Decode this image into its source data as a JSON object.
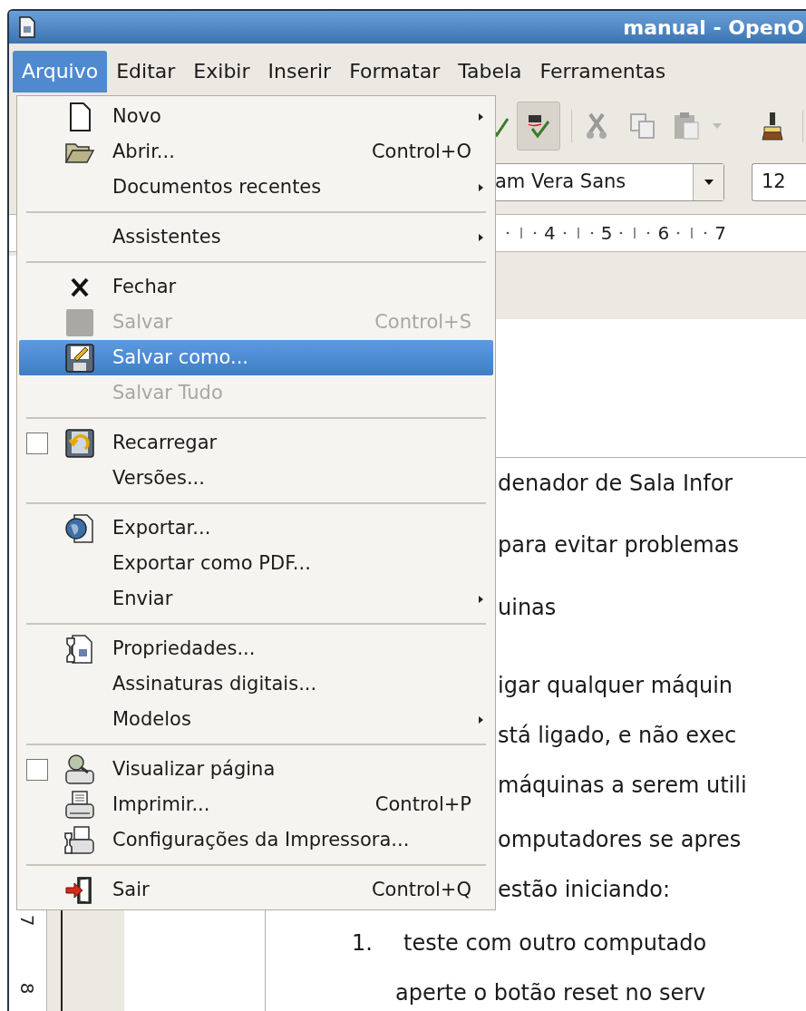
{
  "window": {
    "title": "manual - OpenO"
  },
  "menubar": [
    {
      "label": "Arquivo",
      "selected": true
    },
    {
      "label": "Editar",
      "selected": false
    },
    {
      "label": "Exibir",
      "selected": false
    },
    {
      "label": "Inserir",
      "selected": false
    },
    {
      "label": "Formatar",
      "selected": false
    },
    {
      "label": "Tabela",
      "selected": false
    },
    {
      "label": "Ferramentas",
      "selected": false
    }
  ],
  "toolbar": {
    "auto_spellcheck_on": true,
    "font_name": "am Vera Sans",
    "font_size": "12"
  },
  "ruler": [
    "4",
    "5",
    "6",
    "7"
  ],
  "vertical_ruler": [
    "7",
    "8"
  ],
  "file_menu": {
    "items": [
      {
        "kind": "item",
        "label": "Novo",
        "submenu": true,
        "selected": false,
        "disabled": false
      },
      {
        "kind": "item",
        "label": "Abrir...",
        "shortcut": "Control+O",
        "submenu": false,
        "selected": false,
        "disabled": false
      },
      {
        "kind": "item",
        "label": "Documentos recentes",
        "submenu": true,
        "selected": false,
        "disabled": false
      },
      {
        "kind": "separator"
      },
      {
        "kind": "item",
        "label": "Assistentes",
        "submenu": true,
        "selected": false,
        "disabled": false
      },
      {
        "kind": "separator"
      },
      {
        "kind": "item",
        "label": "Fechar",
        "submenu": false,
        "selected": false,
        "disabled": false
      },
      {
        "kind": "item",
        "label": "Salvar",
        "shortcut": "Control+S",
        "submenu": false,
        "selected": false,
        "disabled": true
      },
      {
        "kind": "item",
        "label": "Salvar como...",
        "submenu": false,
        "selected": true,
        "disabled": false
      },
      {
        "kind": "item",
        "label": "Salvar Tudo",
        "submenu": false,
        "selected": false,
        "disabled": true
      },
      {
        "kind": "separator"
      },
      {
        "kind": "check",
        "label": "Recarregar",
        "checked": false,
        "submenu": false,
        "selected": false,
        "disabled": false
      },
      {
        "kind": "item",
        "label": "Versões...",
        "submenu": false,
        "selected": false,
        "disabled": false
      },
      {
        "kind": "separator"
      },
      {
        "kind": "item",
        "label": "Exportar...",
        "submenu": false,
        "selected": false,
        "disabled": false
      },
      {
        "kind": "item",
        "label": "Exportar como PDF...",
        "submenu": false,
        "selected": false,
        "disabled": false
      },
      {
        "kind": "item",
        "label": "Enviar",
        "submenu": true,
        "selected": false,
        "disabled": false
      },
      {
        "kind": "separator"
      },
      {
        "kind": "item",
        "label": "Propriedades...",
        "submenu": false,
        "selected": false,
        "disabled": false
      },
      {
        "kind": "item",
        "label": "Assinaturas digitais...",
        "submenu": false,
        "selected": false,
        "disabled": false
      },
      {
        "kind": "item",
        "label": "Modelos",
        "submenu": true,
        "selected": false,
        "disabled": false
      },
      {
        "kind": "separator"
      },
      {
        "kind": "check",
        "label": "Visualizar página",
        "checked": false,
        "submenu": false,
        "selected": false,
        "disabled": false
      },
      {
        "kind": "item",
        "label": "Imprimir...",
        "shortcut": "Control+P",
        "submenu": false,
        "selected": false,
        "disabled": false
      },
      {
        "kind": "item",
        "label": "Configurações da Impressora...",
        "submenu": false,
        "selected": false,
        "disabled": false
      },
      {
        "kind": "separator"
      },
      {
        "kind": "item",
        "label": "Sair",
        "shortcut": "Control+Q",
        "submenu": false,
        "selected": false,
        "disabled": false
      }
    ]
  },
  "document": {
    "lines": [
      {
        "kind": "para",
        "text": "denador de Sala Infor"
      },
      {
        "kind": "para",
        "text": "para evitar problemas"
      },
      {
        "kind": "para",
        "text": "uinas"
      },
      {
        "kind": "para",
        "text": "igar qualquer máquin"
      },
      {
        "kind": "para",
        "text": "stá ligado, e não exec"
      },
      {
        "kind": "para",
        "text": "máquinas a serem utili"
      },
      {
        "kind": "para",
        "text": "omputadores se apres"
      },
      {
        "kind": "para",
        "text": "estão iniciando:"
      },
      {
        "kind": "list",
        "number": "1.",
        "text": "teste com outro computado"
      },
      {
        "kind": "cont",
        "text": "aperte o botão reset no serv"
      }
    ]
  }
}
